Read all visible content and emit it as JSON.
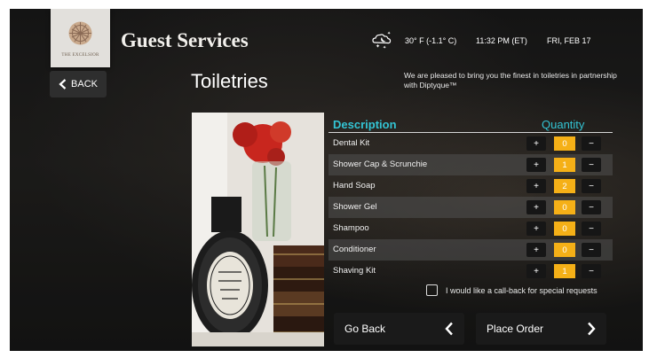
{
  "header": {
    "hotel_name": "THE EXCELSIOR",
    "app_title": "Guest Services",
    "weather_icon": "moon-stars-cloud-icon",
    "temperature": "30° F (-1.1° C)",
    "time": "11:32 PM (ET)",
    "date": "FRI, FEB 17"
  },
  "nav": {
    "back_label": "BACK"
  },
  "page": {
    "title": "Toiletries",
    "intro": "We are pleased to bring you the finest in toiletries in partnership with Diptyque™"
  },
  "table": {
    "col_description": "Description",
    "col_quantity": "Quantity",
    "plus_label": "+",
    "minus_label": "−",
    "rows": [
      {
        "name": "Dental Kit",
        "qty": "0"
      },
      {
        "name": "Shower Cap & Scrunchie",
        "qty": "1"
      },
      {
        "name": "Hand Soap",
        "qty": "2"
      },
      {
        "name": "Shower Gel",
        "qty": "0"
      },
      {
        "name": "Shampoo",
        "qty": "0"
      },
      {
        "name": "Conditioner",
        "qty": "0"
      },
      {
        "name": "Shaving Kit",
        "qty": "1"
      }
    ]
  },
  "callback": {
    "label": "I would like a call-back for special requests",
    "checked": false
  },
  "actions": {
    "go_back_label": "Go Back",
    "place_order_label": "Place Order"
  },
  "colors": {
    "accent_teal": "#33c4d4",
    "qty_orange": "#f5b017"
  }
}
